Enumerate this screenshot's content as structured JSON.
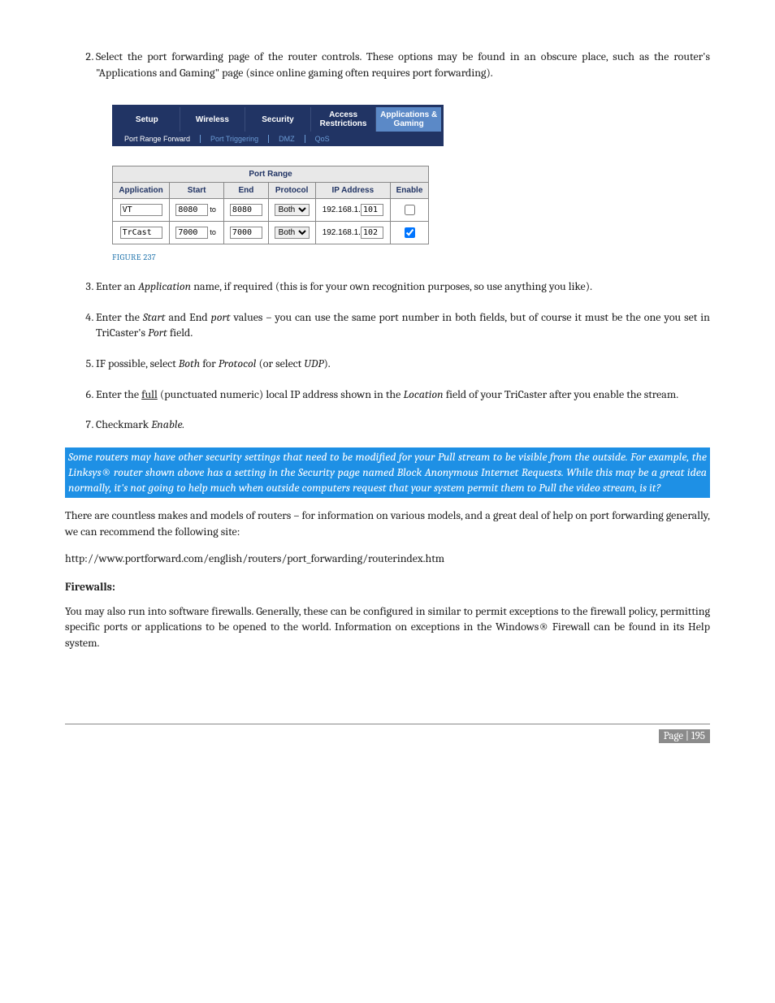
{
  "steps": {
    "s2": "Select the port forwarding page of the router controls.  These options may be found in an obscure place, such as the router's \"Applications and Gaming\" page (since online gaming often requires port forwarding).",
    "s3_a": "Enter an ",
    "s3_b": "Application",
    "s3_c": " name, if required (this is for your own recognition purposes, so use anything you like).",
    "s4_a": " Enter the ",
    "s4_b": "Start",
    "s4_c": " and End ",
    "s4_d": "port",
    "s4_e": " values – you can use the same port number in both fields, but of course it must be the one you set in TriCaster's ",
    "s4_f": "Port",
    "s4_g": " field.",
    "s5_a": "IF possible, select ",
    "s5_b": "Both",
    "s5_c": " for ",
    "s5_d": "Protocol",
    "s5_e": " (or select ",
    "s5_f": "UDP",
    "s5_g": ").",
    "s6_a": "Enter the ",
    "s6_b": "full",
    "s6_c": " (punctuated numeric) local IP address shown in the ",
    "s6_d": "Location",
    "s6_e": " field of your TriCaster after you enable the stream.",
    "s7_a": "Checkmark ",
    "s7_b": "Enable."
  },
  "router": {
    "tabs": {
      "setup": "Setup",
      "wireless": "Wireless",
      "security": "Security",
      "access": "Access Restrictions",
      "apps": "Applications & Gaming"
    },
    "subtabs": {
      "prf": "Port Range Forward",
      "pt": "Port Triggering",
      "dmz": "DMZ",
      "qos": "QoS"
    }
  },
  "table": {
    "title": "Port Range",
    "headers": {
      "app": "Application",
      "start": "Start",
      "end": "End",
      "proto": "Protocol",
      "ip": "IP Address",
      "enable": "Enable"
    },
    "to": "to",
    "ip_prefix": "192.168.1.",
    "rows": [
      {
        "app": "VT",
        "start": "8080",
        "end": "8080",
        "proto": "Both",
        "iplast": "101",
        "enabled": false
      },
      {
        "app": "TrCast",
        "start": "7000",
        "end": "7000",
        "proto": "Both",
        "iplast": "102",
        "enabled": true
      }
    ]
  },
  "figure_caption": "FIGURE 237",
  "blue_note": "Some routers may have other security settings that need to be modified for your Pull stream to be visible from the outside.  For example, the Linksys® router shown above has a setting in the Security page named Block Anonymous Internet Requests.  While this may be a great idea normally, it's not going to help much when outside computers request that your system permit them to Pull the video stream, is it?",
  "para1": "There are countless makes and models of routers – for information on various models, and a great deal of help on port forwarding generally, we can recommend the following site:",
  "url": "http://www.portforward.com/english/routers/port_forwarding/routerindex.htm",
  "firewalls_head": "Firewalls:",
  "firewalls_body": "You may also run into software firewalls.  Generally, these can be configured in similar to permit exceptions to the firewall policy, permitting specific ports or applications to be opened to the world. Information on exceptions in the Windows® Firewall can be found in its Help system.",
  "footer": {
    "label": "Page | ",
    "num": "195"
  }
}
